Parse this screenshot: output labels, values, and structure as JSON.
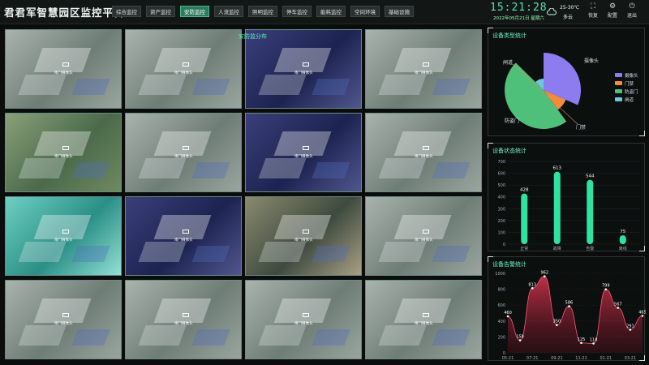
{
  "app": {
    "title": "君君军智慧园区监控平台"
  },
  "nav": {
    "items": [
      "综合监控",
      "资产监控",
      "安防监控",
      "人流监控",
      "照明监控",
      "停车监控",
      "能耗监控",
      "空间环境",
      "基础设施"
    ],
    "active": 2
  },
  "time": {
    "clock": "15:21:28",
    "date": "2022年05月21日 星期六"
  },
  "weather": {
    "temp": "25-30℃",
    "desc": "多云",
    "icon": "cloud-icon"
  },
  "tools": [
    {
      "label": "恢复",
      "icon": "restore-icon"
    },
    {
      "label": "配置",
      "icon": "gear-icon"
    },
    {
      "label": "退出",
      "icon": "power-icon"
    }
  ],
  "cameras": {
    "overlay_title": "安防监分布",
    "label": "南门摄像头",
    "tiles": [
      {
        "tone": "day"
      },
      {
        "tone": "day"
      },
      {
        "tone": "night"
      },
      {
        "tone": "day"
      },
      {
        "tone": "green"
      },
      {
        "tone": "day"
      },
      {
        "tone": "night"
      },
      {
        "tone": "day"
      },
      {
        "tone": "teal"
      },
      {
        "tone": "night"
      },
      {
        "tone": "dusk"
      },
      {
        "tone": "day"
      },
      {
        "tone": "day"
      },
      {
        "tone": "day"
      },
      {
        "tone": "day"
      },
      {
        "tone": "day"
      }
    ]
  },
  "panels": {
    "type": {
      "title": "设备类型统计",
      "chart_data": {
        "type": "pie",
        "slices": [
          {
            "name": "摄像头",
            "value": 30,
            "color": "#8c7cf0"
          },
          {
            "name": "门禁",
            "value": 8,
            "color": "#f28c3a"
          },
          {
            "name": "防盗门",
            "value": 45,
            "color": "#4fc07a"
          },
          {
            "name": "闸道",
            "value": 12,
            "color": "#6fc6e0"
          }
        ]
      }
    },
    "status": {
      "title": "设备状态统计",
      "chart_data": {
        "type": "bar",
        "categories": [
          "正常",
          "故障",
          "告警",
          "离线"
        ],
        "values": [
          428,
          613,
          544,
          75
        ],
        "ylim": [
          0,
          700
        ],
        "yticks": [
          0,
          100,
          200,
          300,
          400,
          500,
          600,
          700
        ]
      }
    },
    "alarm": {
      "title": "设备告警统计",
      "chart_data": {
        "type": "area",
        "x": [
          "05-21",
          "06-21",
          "07-21",
          "08-21",
          "09-21",
          "10-21",
          "11-21",
          "12-21",
          "01-21",
          "02-21",
          "03-21",
          "04-21"
        ],
        "xticks": [
          "05-21",
          "07-21",
          "09-21",
          "11-21",
          "01-21",
          "03-21"
        ],
        "values": [
          460,
          158,
          813,
          962,
          350,
          586,
          125,
          118,
          799,
          567,
          291,
          465
        ],
        "ylim": [
          0,
          1000
        ],
        "yticks": [
          0,
          200,
          400,
          600,
          800,
          1000
        ]
      }
    }
  }
}
